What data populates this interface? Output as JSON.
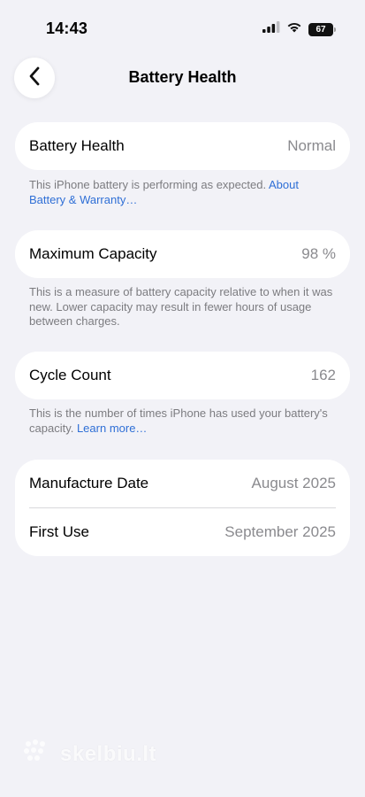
{
  "status_bar": {
    "time": "14:43",
    "battery_level": "67"
  },
  "nav": {
    "title": "Battery Health",
    "back_icon": "chevron-left-icon"
  },
  "battery_health": {
    "label": "Battery Health",
    "value": "Normal",
    "note": "This iPhone battery is performing as expected. ",
    "link": "About Battery & Warranty…"
  },
  "maximum_capacity": {
    "label": "Maximum Capacity",
    "value": "98 %",
    "note": "This is a measure of battery capacity relative to when it was new. Lower capacity may result in fewer hours of usage between charges."
  },
  "cycle_count": {
    "label": "Cycle Count",
    "value": "162",
    "note": "This is the number of times iPhone has used your battery's capacity. ",
    "link": "Learn more…"
  },
  "dates": {
    "manufacture_label": "Manufacture Date",
    "manufacture_value": "August 2025",
    "first_use_label": "First Use",
    "first_use_value": "September 2025"
  },
  "watermark": {
    "text": "skelbiu.lt"
  },
  "colors": {
    "background": "#f2f2f7",
    "link": "#2f6fd6",
    "secondary_text": "#8a8a8e"
  }
}
